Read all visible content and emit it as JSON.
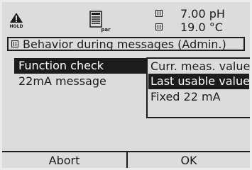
{
  "status": {
    "hold_label": "HOLD",
    "par_label": "par",
    "ph_reading": "7.00 pH",
    "temp_reading": "19.0 °C"
  },
  "header": {
    "title": "Behavior during messages (Admin.)"
  },
  "menu": {
    "items": [
      {
        "label": "Function check"
      },
      {
        "label": "22mA message"
      }
    ]
  },
  "dropdown": {
    "options": [
      {
        "label": "Curr. meas. value"
      },
      {
        "label": "Last usable  value"
      },
      {
        "label": "Fixed  22 mA"
      }
    ]
  },
  "softkeys": {
    "left": "Abort",
    "right": "OK"
  }
}
